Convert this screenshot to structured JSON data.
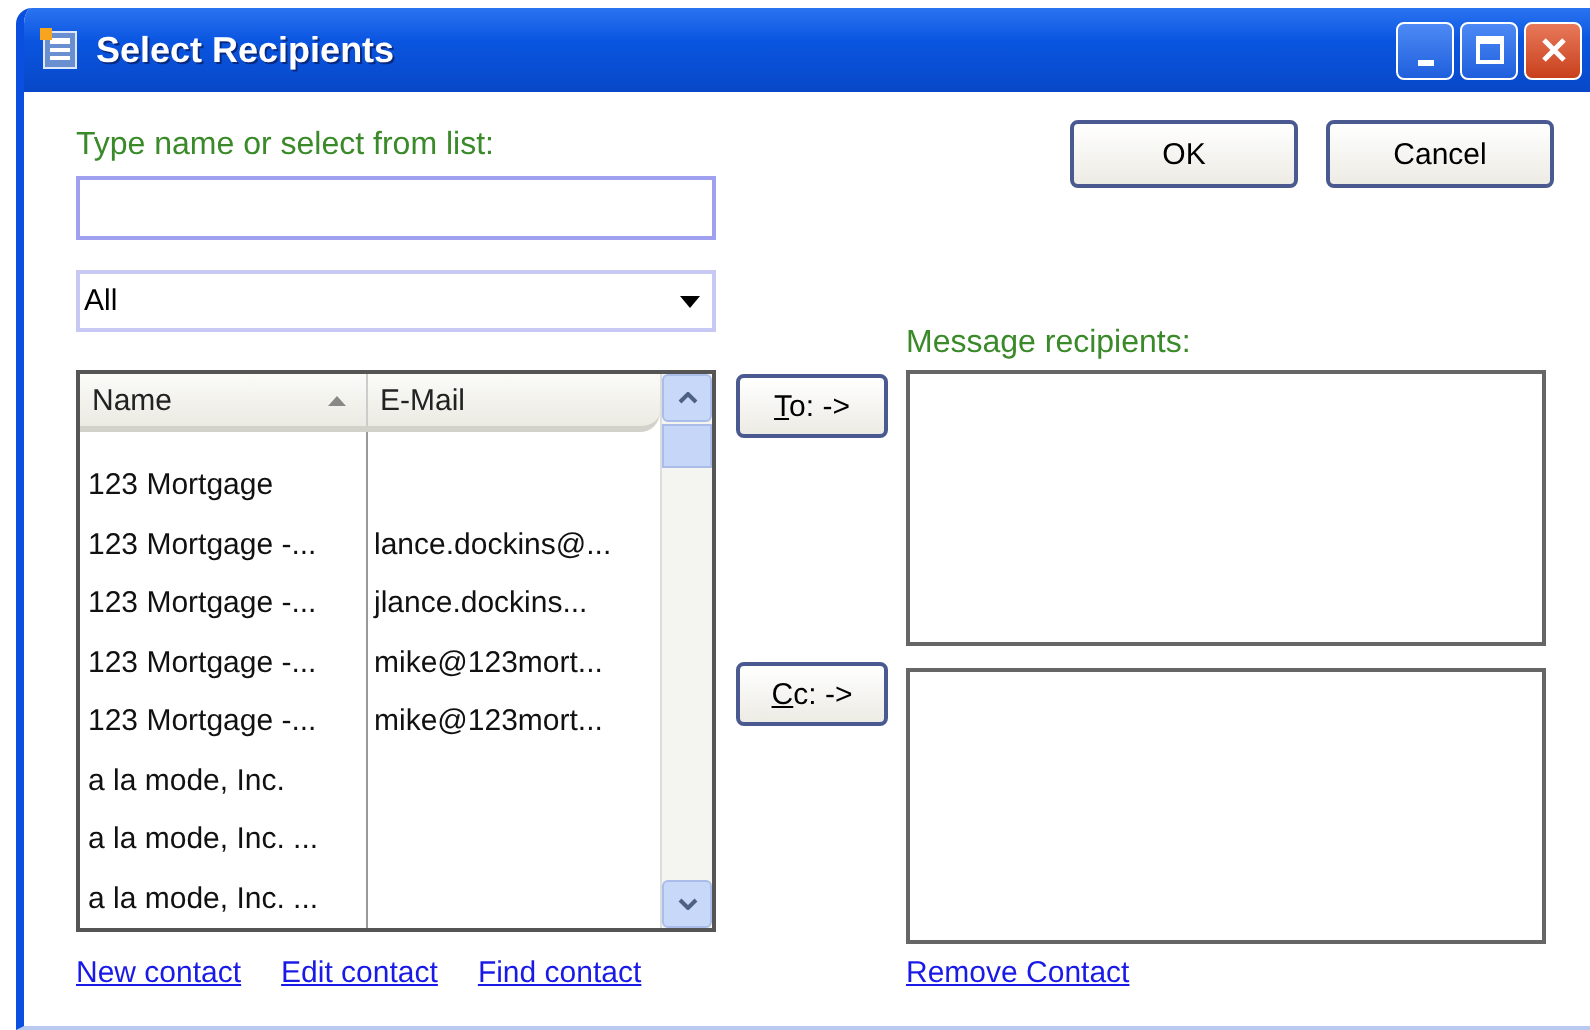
{
  "window": {
    "title": "Select Recipients"
  },
  "search": {
    "label": "Type name or select from list:"
  },
  "address_book": {
    "value": "All"
  },
  "buttons": [
    {
      "label": "OK"
    },
    {
      "label": "Cancel"
    }
  ],
  "table": {
    "columns": [
      {
        "label": "Name",
        "sorted": true
      },
      {
        "label": "E-Mail",
        "sorted": false
      }
    ],
    "rows": [
      {
        "name": "123 Mortgage"
      },
      {
        "name": "123 Mortgage -...",
        "email": "lance.dockins@..."
      },
      {
        "name": "123 Mortgage -...",
        "email": "jlance.dockins..."
      },
      {
        "name": "123 Mortgage -...",
        "email": "mike@123mort..."
      },
      {
        "name": "123 Mortgage -...",
        "email": "mike@123mort..."
      },
      {
        "name": "a la mode, Inc."
      },
      {
        "name": "a la mode, Inc. ..."
      },
      {
        "name": "a la mode, Inc. ..."
      }
    ]
  },
  "recipients_label": "Message recipients:",
  "recipient_buttons": [
    {
      "access_key": "T",
      "rest": "o: ->"
    },
    {
      "access_key": "C",
      "rest": "c: ->"
    }
  ],
  "links": [
    {
      "label": "New contact"
    },
    {
      "label": "Edit contact"
    },
    {
      "label": "Find contact"
    }
  ],
  "remove_link": {
    "label": "Remove Contact"
  }
}
